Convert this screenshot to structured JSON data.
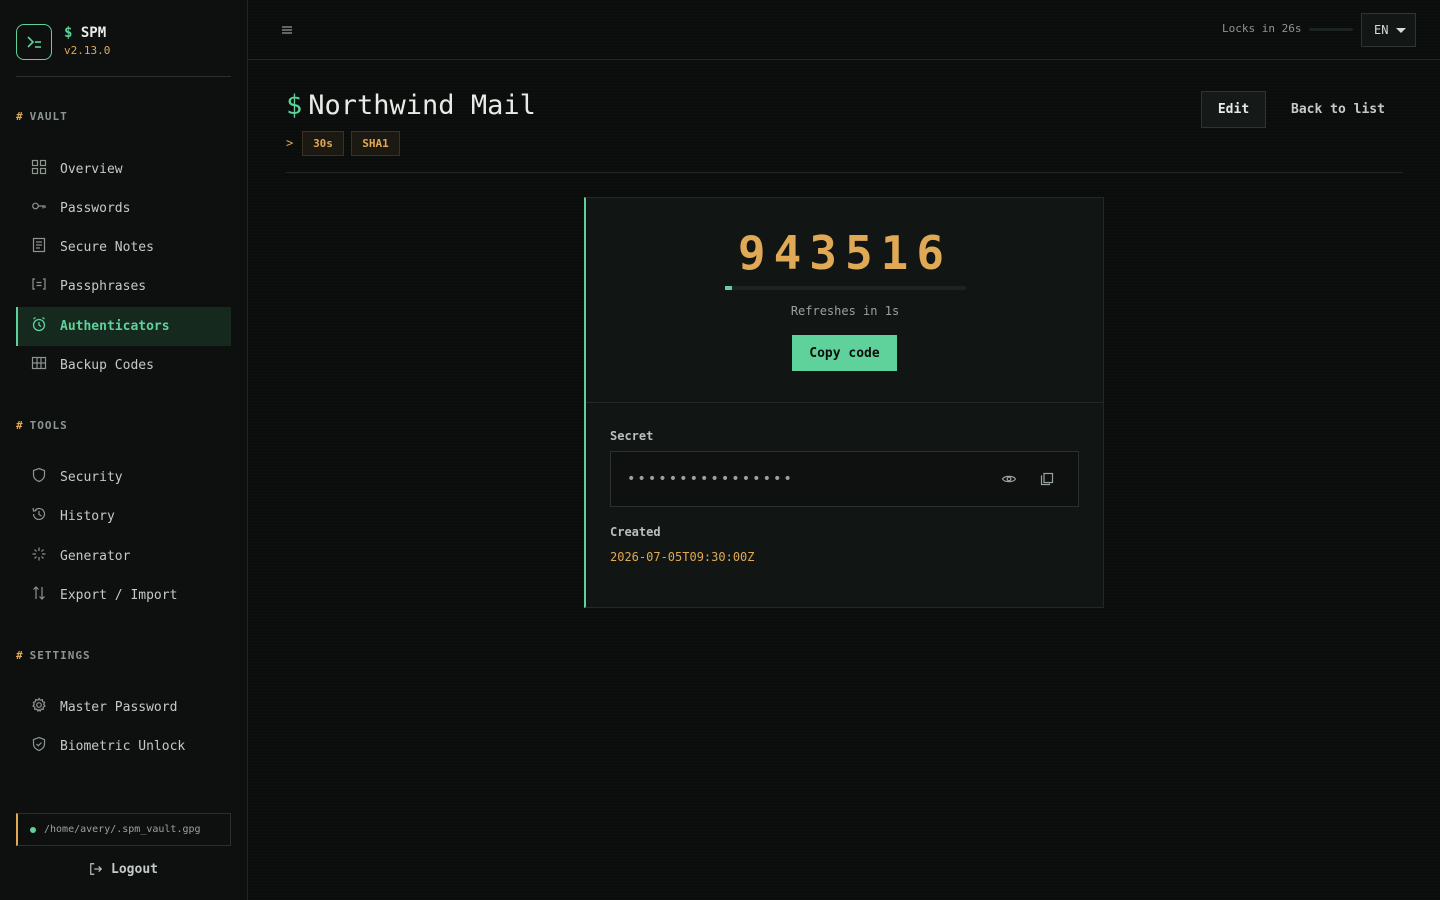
{
  "brand": {
    "prompt": "$",
    "name": "SPM",
    "version": "v2.13.0",
    "logo_icon": "terminal-icon"
  },
  "sidebar": {
    "sections": [
      {
        "hash": "#",
        "title": "VAULT",
        "items": [
          {
            "label": "Overview",
            "icon": "grid-icon"
          },
          {
            "label": "Passwords",
            "icon": "key-icon"
          },
          {
            "label": "Secure Notes",
            "icon": "note-icon"
          },
          {
            "label": "Passphrases",
            "icon": "bracket-equals-icon"
          },
          {
            "label": "Authenticators",
            "icon": "clock-icon",
            "active": true
          },
          {
            "label": "Backup Codes",
            "icon": "table-icon"
          }
        ]
      },
      {
        "hash": "#",
        "title": "TOOLS",
        "items": [
          {
            "label": "Security",
            "icon": "shield-icon"
          },
          {
            "label": "History",
            "icon": "history-icon"
          },
          {
            "label": "Generator",
            "icon": "sparkle-icon"
          },
          {
            "label": "Export / Import",
            "icon": "arrows-up-down-icon"
          }
        ]
      },
      {
        "hash": "#",
        "title": "SETTINGS",
        "items": [
          {
            "label": "Master Password",
            "icon": "gear-icon"
          },
          {
            "label": "Biometric Unlock",
            "icon": "shield-check-icon"
          }
        ]
      }
    ],
    "vault_path": "/home/avery/.spm_vault.gpg",
    "logout_label": "Logout"
  },
  "topbar": {
    "lock_text": "Locks in 26s",
    "lock_fraction": 0.87,
    "language": "EN"
  },
  "page": {
    "prompt": "$",
    "title": "Northwind Mail",
    "prompt_chevron": ">",
    "tags": [
      "30s",
      "SHA1"
    ],
    "edit_label": "Edit",
    "back_label": "Back to list"
  },
  "authenticator": {
    "code": "943516",
    "progress_fraction": 0.03,
    "refresh_text": "Refreshes in 1s",
    "copy_label": "Copy code",
    "secret_label": "Secret",
    "secret_mask": "••••••••••••••••",
    "created_label": "Created",
    "created_value": "2026-07-05T09:30:00Z"
  },
  "colors": {
    "accent": "#5fd19a",
    "amber": "#e0a955",
    "background": "#0b0d0c"
  }
}
